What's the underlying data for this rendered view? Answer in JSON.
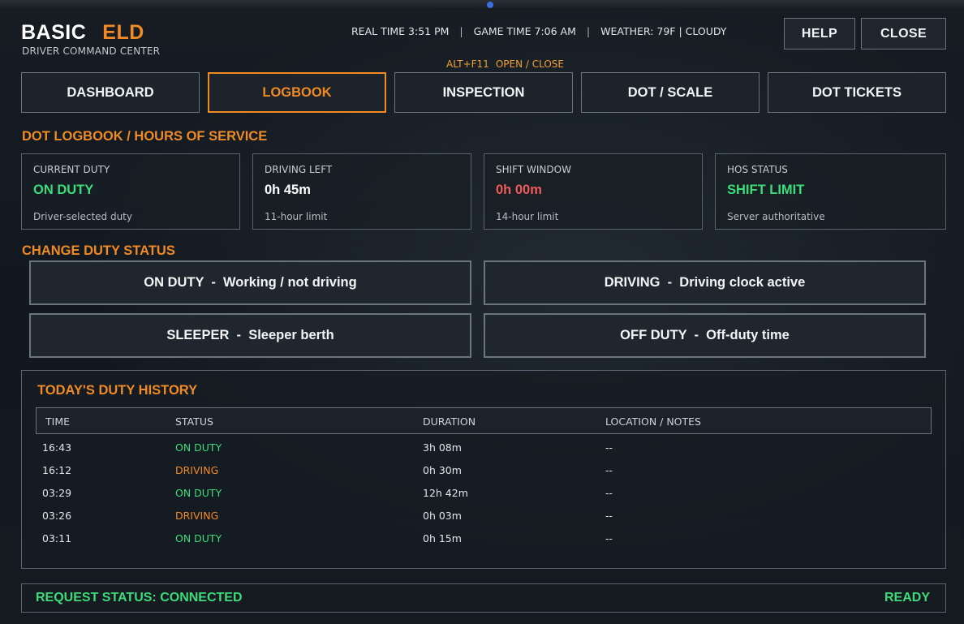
{
  "header": {
    "brand_primary": "BASIC",
    "brand_accent": "ELD",
    "subtitle": "DRIVER COMMAND CENTER",
    "real_time": "REAL TIME 3:51 PM",
    "game_time": "GAME TIME 7:06 AM",
    "weather": "WEATHER: 79F | CLOUDY",
    "separator": "|",
    "hotkey_keys": "ALT+F11",
    "hotkey_action": "OPEN / CLOSE",
    "help_label": "HELP",
    "close_label": "CLOSE"
  },
  "tabs": [
    {
      "label": "DASHBOARD",
      "active": false
    },
    {
      "label": "LOGBOOK",
      "active": true
    },
    {
      "label": "INSPECTION",
      "active": false
    },
    {
      "label": "DOT / SCALE",
      "active": false
    },
    {
      "label": "DOT TICKETS",
      "active": false
    }
  ],
  "logbook": {
    "section_title": "DOT LOGBOOK / HOURS OF SERVICE",
    "cards": [
      {
        "label": "CURRENT DUTY",
        "value": "ON DUTY",
        "note": "Driver-selected duty",
        "value_color": "#3ddc7a"
      },
      {
        "label": "DRIVING LEFT",
        "value": "0h 45m",
        "note": "11-hour limit",
        "value_color": "#ffffff"
      },
      {
        "label": "SHIFT WINDOW",
        "value": "0h 00m",
        "note": "14-hour limit",
        "value_color": "#f05a5a"
      },
      {
        "label": "HOS STATUS",
        "value": "SHIFT LIMIT",
        "note": "Server authoritative",
        "value_color": "#3ddc7a"
      }
    ]
  },
  "change_duty": {
    "title": "CHANGE DUTY STATUS",
    "buttons": [
      {
        "label": "ON DUTY  -  Working / not driving"
      },
      {
        "label": "DRIVING  -  Driving clock active"
      },
      {
        "label": "SLEEPER  -  Sleeper berth"
      },
      {
        "label": "OFF DUTY  -  Off-duty time"
      }
    ]
  },
  "history": {
    "title": "TODAY'S DUTY HISTORY",
    "columns": [
      "TIME",
      "STATUS",
      "DURATION",
      "LOCATION / NOTES"
    ],
    "rows": [
      {
        "time": "16:43",
        "status": "ON DUTY",
        "duration": "3h 08m",
        "notes": "--",
        "status_color": "#3ddc7a"
      },
      {
        "time": "16:12",
        "status": "DRIVING",
        "duration": "0h 30m",
        "notes": "--",
        "status_color": "#f08a24"
      },
      {
        "time": "03:29",
        "status": "ON DUTY",
        "duration": "12h 42m",
        "notes": "--",
        "status_color": "#3ddc7a"
      },
      {
        "time": "03:26",
        "status": "DRIVING",
        "duration": "0h 03m",
        "notes": "--",
        "status_color": "#f08a24"
      },
      {
        "time": "03:11",
        "status": "ON DUTY",
        "duration": "0h 15m",
        "notes": "--",
        "status_color": "#3ddc7a"
      }
    ]
  },
  "status_bar": {
    "request_status": "REQUEST STATUS: CONNECTED",
    "ready": "READY"
  },
  "colors": {
    "accent": "#f08a24",
    "positive": "#3ddc7a",
    "negative": "#f05a5a",
    "border": "#6b7580"
  }
}
